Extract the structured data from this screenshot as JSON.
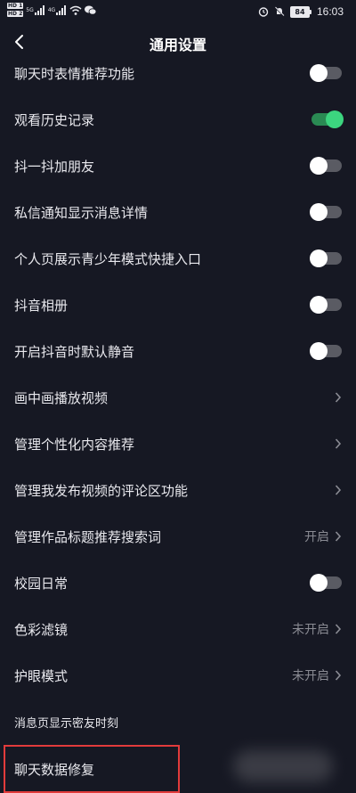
{
  "status_bar": {
    "sim1": "HD 1",
    "sim2": "HD 2",
    "net1": "5G",
    "net2": "4G",
    "battery": "84",
    "time": "16:03"
  },
  "header": {
    "title": "通用设置"
  },
  "settings": [
    {
      "label": "聊天时表情推荐功能",
      "type": "toggle",
      "on": false
    },
    {
      "label": "观看历史记录",
      "type": "toggle",
      "on": true
    },
    {
      "label": "抖一抖加朋友",
      "type": "toggle",
      "on": false
    },
    {
      "label": "私信通知显示消息详情",
      "type": "toggle",
      "on": false
    },
    {
      "label": "个人页展示青少年模式快捷入口",
      "type": "toggle",
      "on": false
    },
    {
      "label": "抖音相册",
      "type": "toggle",
      "on": false
    },
    {
      "label": "开启抖音时默认静音",
      "type": "toggle",
      "on": false
    },
    {
      "label": "画中画播放视频",
      "type": "link"
    },
    {
      "label": "管理个性化内容推荐",
      "type": "link"
    },
    {
      "label": "管理我发布视频的评论区功能",
      "type": "link"
    },
    {
      "label": "管理作品标题推荐搜索词",
      "type": "link",
      "value": "开启"
    },
    {
      "label": "校园日常",
      "type": "toggle",
      "on": false
    },
    {
      "label": "色彩滤镜",
      "type": "link",
      "value": "未开启"
    },
    {
      "label": "护眼模式",
      "type": "link",
      "value": "未开启"
    },
    {
      "label": "消息页显示密友时刻",
      "type": "text"
    },
    {
      "label": "聊天数据修复",
      "type": "text",
      "highlighted": true
    }
  ],
  "colors": {
    "background": "#161823",
    "toggle_on": "#3cd57f",
    "highlight_border": "#e23b3b"
  }
}
